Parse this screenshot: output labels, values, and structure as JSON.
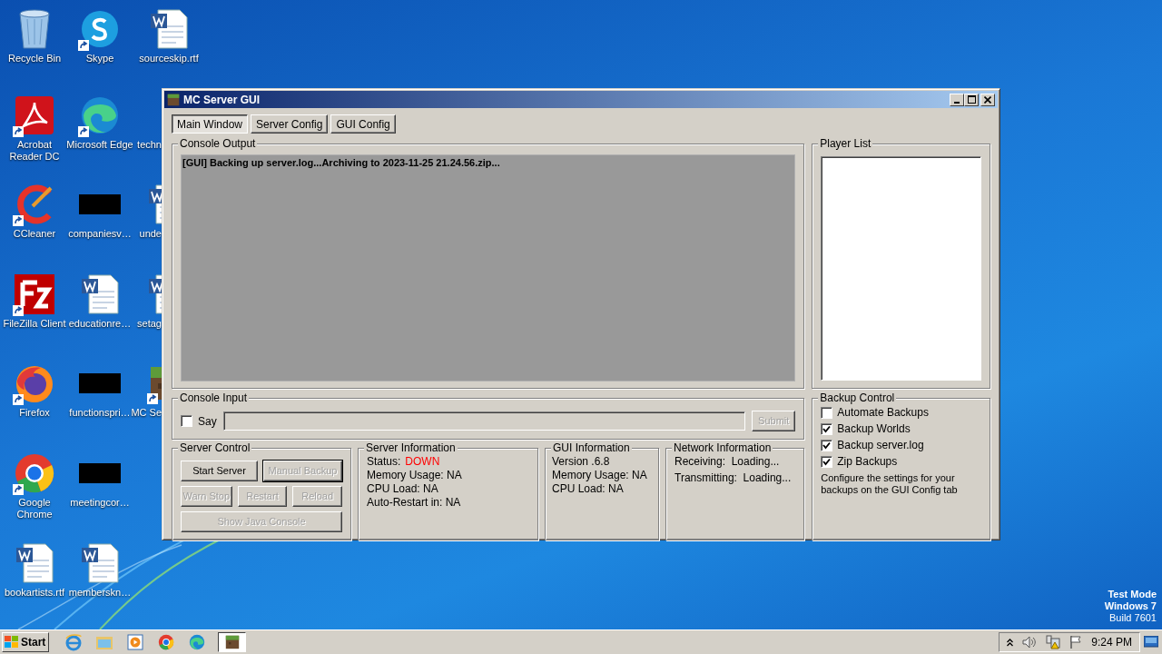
{
  "desktop": {
    "icon_columns": [
      [
        {
          "label": "Recycle Bin",
          "kind": "recycle",
          "shortcut": false,
          "partly_hidden": false
        },
        {
          "label": "Acrobat Reader DC",
          "kind": "acrobat",
          "shortcut": true,
          "partly_hidden": false
        },
        {
          "label": "CCleaner",
          "kind": "ccleaner",
          "shortcut": true,
          "partly_hidden": false
        },
        {
          "label": "FileZilla Client",
          "kind": "filezilla",
          "shortcut": true,
          "partly_hidden": false
        },
        {
          "label": "Firefox",
          "kind": "firefox",
          "shortcut": true,
          "partly_hidden": false
        },
        {
          "label": "Google Chrome",
          "kind": "chrome",
          "shortcut": true,
          "partly_hidden": false
        },
        {
          "label": "bookartists.rtf",
          "kind": "word",
          "shortcut": false,
          "partly_hidden": false
        }
      ],
      [
        {
          "label": "Skype",
          "kind": "skype",
          "shortcut": true,
          "partly_hidden": false
        },
        {
          "label": "Microsoft Edge",
          "kind": "edge",
          "shortcut": true,
          "partly_hidden": false
        },
        {
          "label": "companiesv…",
          "kind": "redacted",
          "shortcut": false,
          "partly_hidden": false
        },
        {
          "label": "educationre…",
          "kind": "word",
          "shortcut": false,
          "partly_hidden": false
        },
        {
          "label": "functionspri…",
          "kind": "redacted",
          "shortcut": false,
          "partly_hidden": false
        },
        {
          "label": "meetingcor…",
          "kind": "redacted",
          "shortcut": false,
          "partly_hidden": false
        },
        {
          "label": "memberskn…",
          "kind": "word",
          "shortcut": false,
          "partly_hidden": false
        }
      ],
      [
        {
          "label": "sourceskip.rtf",
          "kind": "word",
          "shortcut": false,
          "partly_hidden": false
        },
        {
          "label": "techn",
          "kind": "none",
          "partly_hidden": true
        },
        {
          "label": "unde",
          "kind": "word",
          "shortcut": false,
          "partly_hidden": true
        },
        {
          "label": "setag",
          "kind": "word",
          "shortcut": false,
          "partly_hidden": true
        },
        {
          "label": "MC Se",
          "kind": "minecraft",
          "shortcut": true,
          "partly_hidden": true
        }
      ]
    ],
    "os_notice": [
      {
        "text": "Test Mode",
        "bold": true
      },
      {
        "text": "Windows 7",
        "bold": true
      },
      {
        "text": "Build 7601",
        "bold": false
      }
    ]
  },
  "window": {
    "title": "MC Server GUI",
    "tabs": [
      {
        "label": "Main Window",
        "selected": true
      },
      {
        "label": "Server Config",
        "selected": false
      },
      {
        "label": "GUI Config",
        "selected": false
      }
    ],
    "console_output": {
      "title": "Console Output",
      "lines": [
        "[GUI] Backing up server.log...Archiving to 2023-11-25 21.24.56.zip..."
      ]
    },
    "player_list": {
      "title": "Player List"
    },
    "console_input": {
      "title": "Console Input",
      "say": {
        "label": "Say",
        "checked": false
      },
      "submit": {
        "label": "Submit",
        "disabled": true
      }
    },
    "server_control": {
      "title": "Server Control",
      "rows": [
        [
          {
            "label": "Start Server",
            "disabled": false,
            "focused": false
          },
          {
            "label": "Manual Backup",
            "disabled": true,
            "focused": true
          }
        ],
        [
          {
            "label": "Warn Stop",
            "disabled": true,
            "focused": false
          },
          {
            "label": "Restart",
            "disabled": true,
            "focused": false
          },
          {
            "label": "Reload",
            "disabled": true,
            "focused": false
          }
        ],
        [
          {
            "label": "Show Java Console",
            "disabled": true,
            "focused": false
          }
        ]
      ]
    },
    "server_information": {
      "title": "Server Information",
      "lines": [
        {
          "label": "Status:",
          "value": "DOWN",
          "alert": true
        },
        {
          "label": "Memory Usage: NA",
          "alert": false
        },
        {
          "label": "CPU Load: NA",
          "alert": false
        },
        {
          "label": "Auto-Restart in: NA",
          "alert": false
        }
      ]
    },
    "gui_information": {
      "title": "GUI Information",
      "lines": [
        "Version .6.8",
        "Memory Usage: NA",
        "CPU Load: NA"
      ]
    },
    "network_information": {
      "title": "Network Information",
      "lines": [
        "Receiving:  Loading...",
        "Transmitting:  Loading..."
      ]
    },
    "backup_control": {
      "title": "Backup Control",
      "options": [
        {
          "label": "Automate Backups",
          "checked": false
        },
        {
          "label": "Backup Worlds",
          "checked": true
        },
        {
          "label": "Backup server.log",
          "checked": true
        },
        {
          "label": "Zip Backups",
          "checked": true
        }
      ],
      "note": "Configure the settings for your backups on the GUI Config tab"
    }
  },
  "taskbar": {
    "start": "Start",
    "apps": [
      {
        "kind": "ie",
        "active": false
      },
      {
        "kind": "explorer",
        "active": false
      },
      {
        "kind": "media",
        "active": false
      },
      {
        "kind": "chrome",
        "active": false
      },
      {
        "kind": "edge",
        "active": false
      },
      {
        "kind": "minecraft",
        "active": true
      }
    ],
    "time": "9:24 PM"
  }
}
